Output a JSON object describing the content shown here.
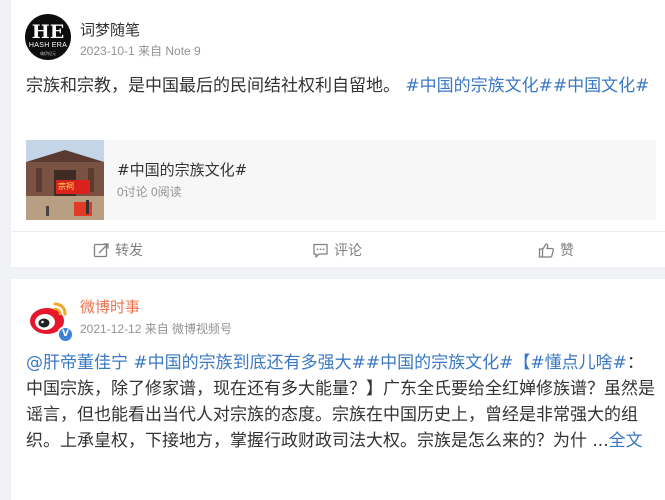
{
  "posts": [
    {
      "avatar": {
        "monogram": "HE",
        "brand": "HASH ERA",
        "sub": "嗨伊纪元"
      },
      "username": "词梦随笔",
      "meta": "2023-10-1 来自 Note 9",
      "text_plain": "宗族和宗教，是中国最后的民间结社权利自留地。 ",
      "text_link": "#中国的宗族文化##中国文化#",
      "topic_card": {
        "title": "#中国的宗族文化#",
        "stats": "0讨论 0阅读",
        "image_banner": "宗祠"
      },
      "actions": {
        "repost": "转发",
        "comment": "评论",
        "like": "赞"
      }
    },
    {
      "username": "微博时事",
      "meta": "2021-12-12 来自 微博视频号",
      "text_link1": "@肝帝董佳宁 #中国的宗族到底还有多强大##中国的宗族文化#【#懂点儿啥#",
      "text_plain": "：中国宗族，除了修家谱，现在还有多大能量？】广东全氏要给全红婵修族谱？虽然是谣言，但也能看出当代人对宗族的态度。宗族在中国历史上，曾经是非常强大的组织。上承皇权，下接地方，掌握行政财政司法大权。宗族是怎么来的？为什 ...",
      "text_link2": "全文"
    }
  ],
  "colors": {
    "link": "#3a78c3",
    "weibo_orange": "#eb7350",
    "meta_gray": "#939393",
    "verified_blue": "#3b82d6",
    "background": "#f1f2f5"
  },
  "icons": [
    "repost-icon",
    "comment-icon",
    "like-icon",
    "verified-icon"
  ]
}
